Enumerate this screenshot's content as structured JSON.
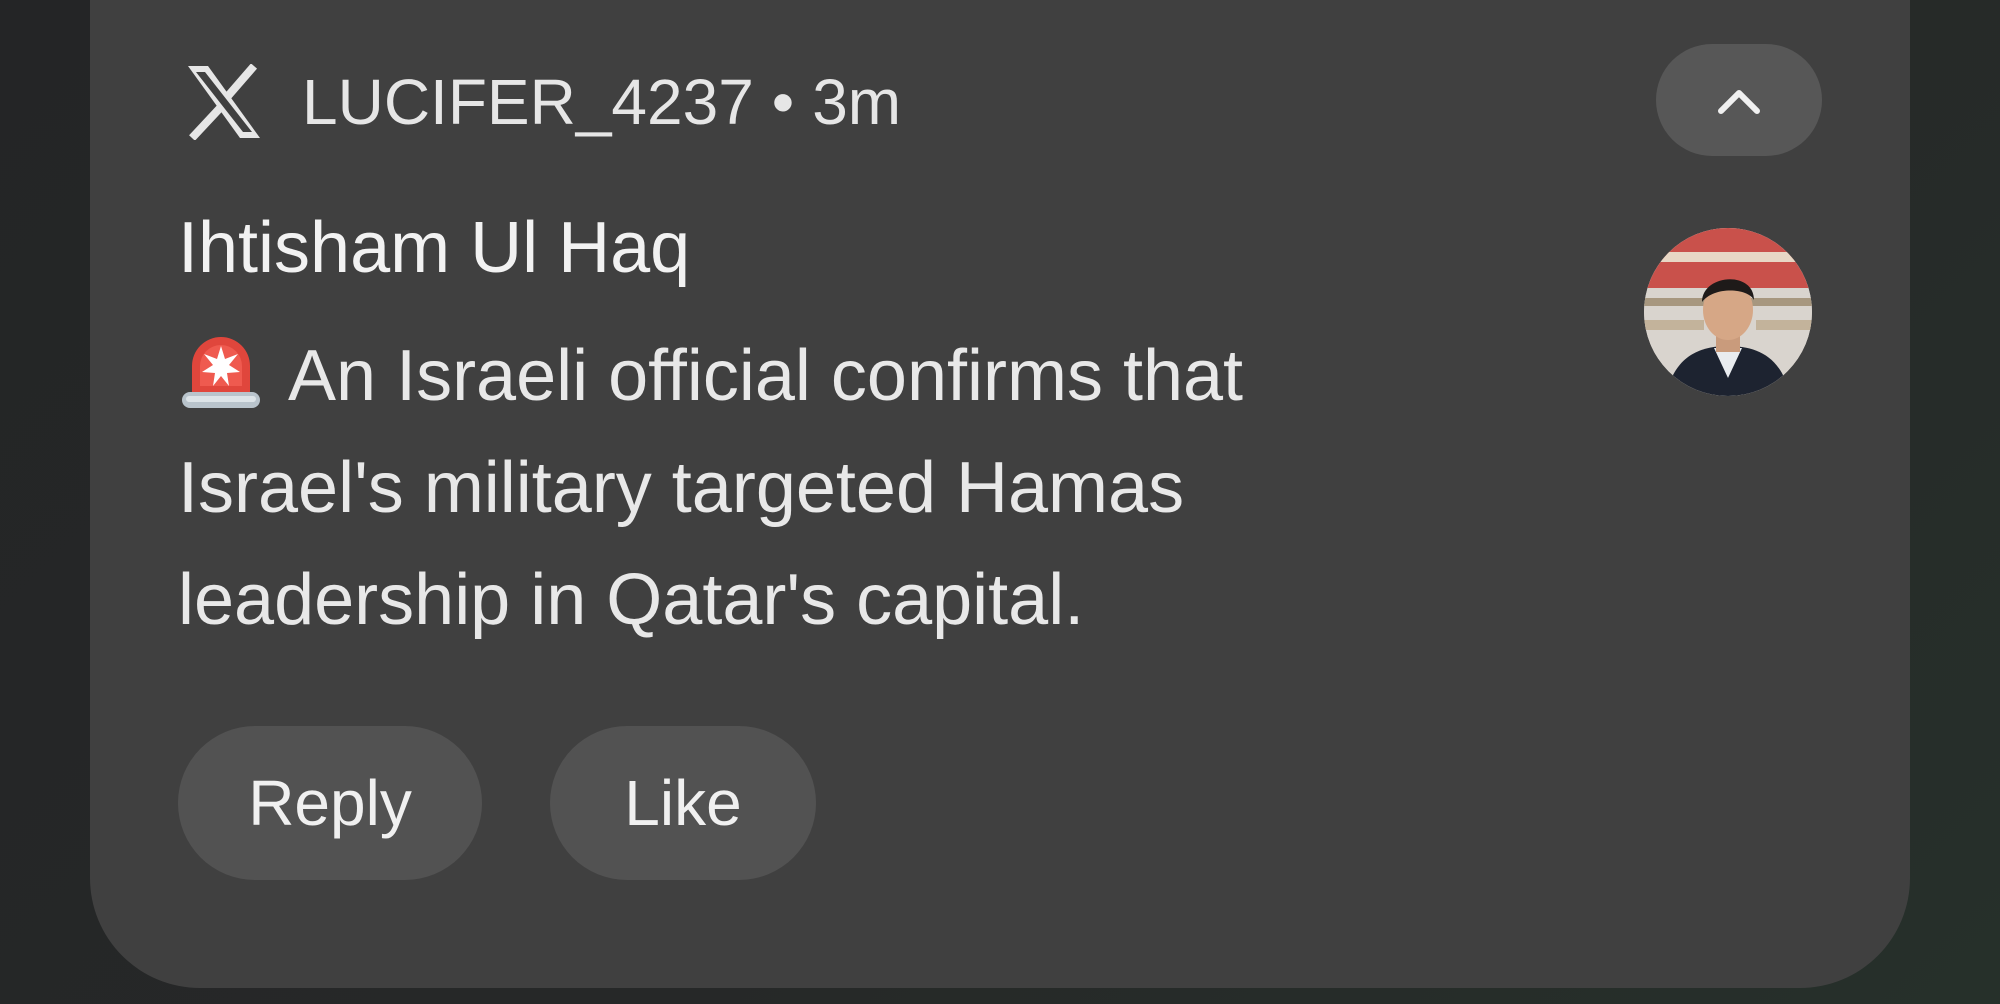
{
  "notification": {
    "app_icon": "x-logo-icon",
    "account": "LUCIFER_4237",
    "separator": "•",
    "time_ago": "3m",
    "collapse_icon": "chevron-up-icon",
    "sender_name": "Ihtisham Ul Haq",
    "message_icon": "police-siren-icon",
    "message_lines": [
      "An Israeli official confirms that",
      "Israel's military targeted Hamas",
      "leadership in Qatar's capital."
    ],
    "avatar": "profile-avatar",
    "actions": {
      "reply_label": "Reply",
      "like_label": "Like"
    }
  },
  "colors": {
    "background": "#252627",
    "card": "#404040",
    "button": "#525252",
    "text": "#e8e8e8"
  }
}
